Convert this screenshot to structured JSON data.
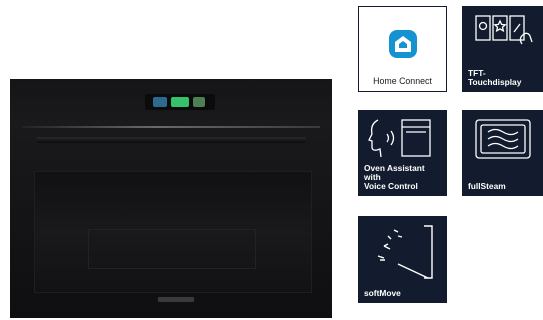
{
  "product": {
    "brand_icon": "siemens-wordmark"
  },
  "features": [
    {
      "id": "home-connect",
      "icon": "home-connect-icon",
      "lines": [
        "Home Connect"
      ]
    },
    {
      "id": "tft-touchdisplay",
      "icon": "touch-display-icon",
      "lines": [
        "TFT-",
        "Touchdisplay"
      ]
    },
    {
      "id": "oven-assistant",
      "icon": "voice-assistant-icon",
      "lines": [
        "Oven Assistant",
        "with",
        "Voice Control"
      ]
    },
    {
      "id": "fullsteam",
      "icon": "steam-icon",
      "lines": [
        "fullSteam"
      ]
    },
    {
      "id": "softmove",
      "icon": "soft-close-door-icon",
      "lines": [
        "softMove"
      ]
    }
  ],
  "colors": {
    "tile_bg": "#121c2e",
    "home_connect_blue": "#1493d0",
    "display_green": "#35c26a"
  }
}
